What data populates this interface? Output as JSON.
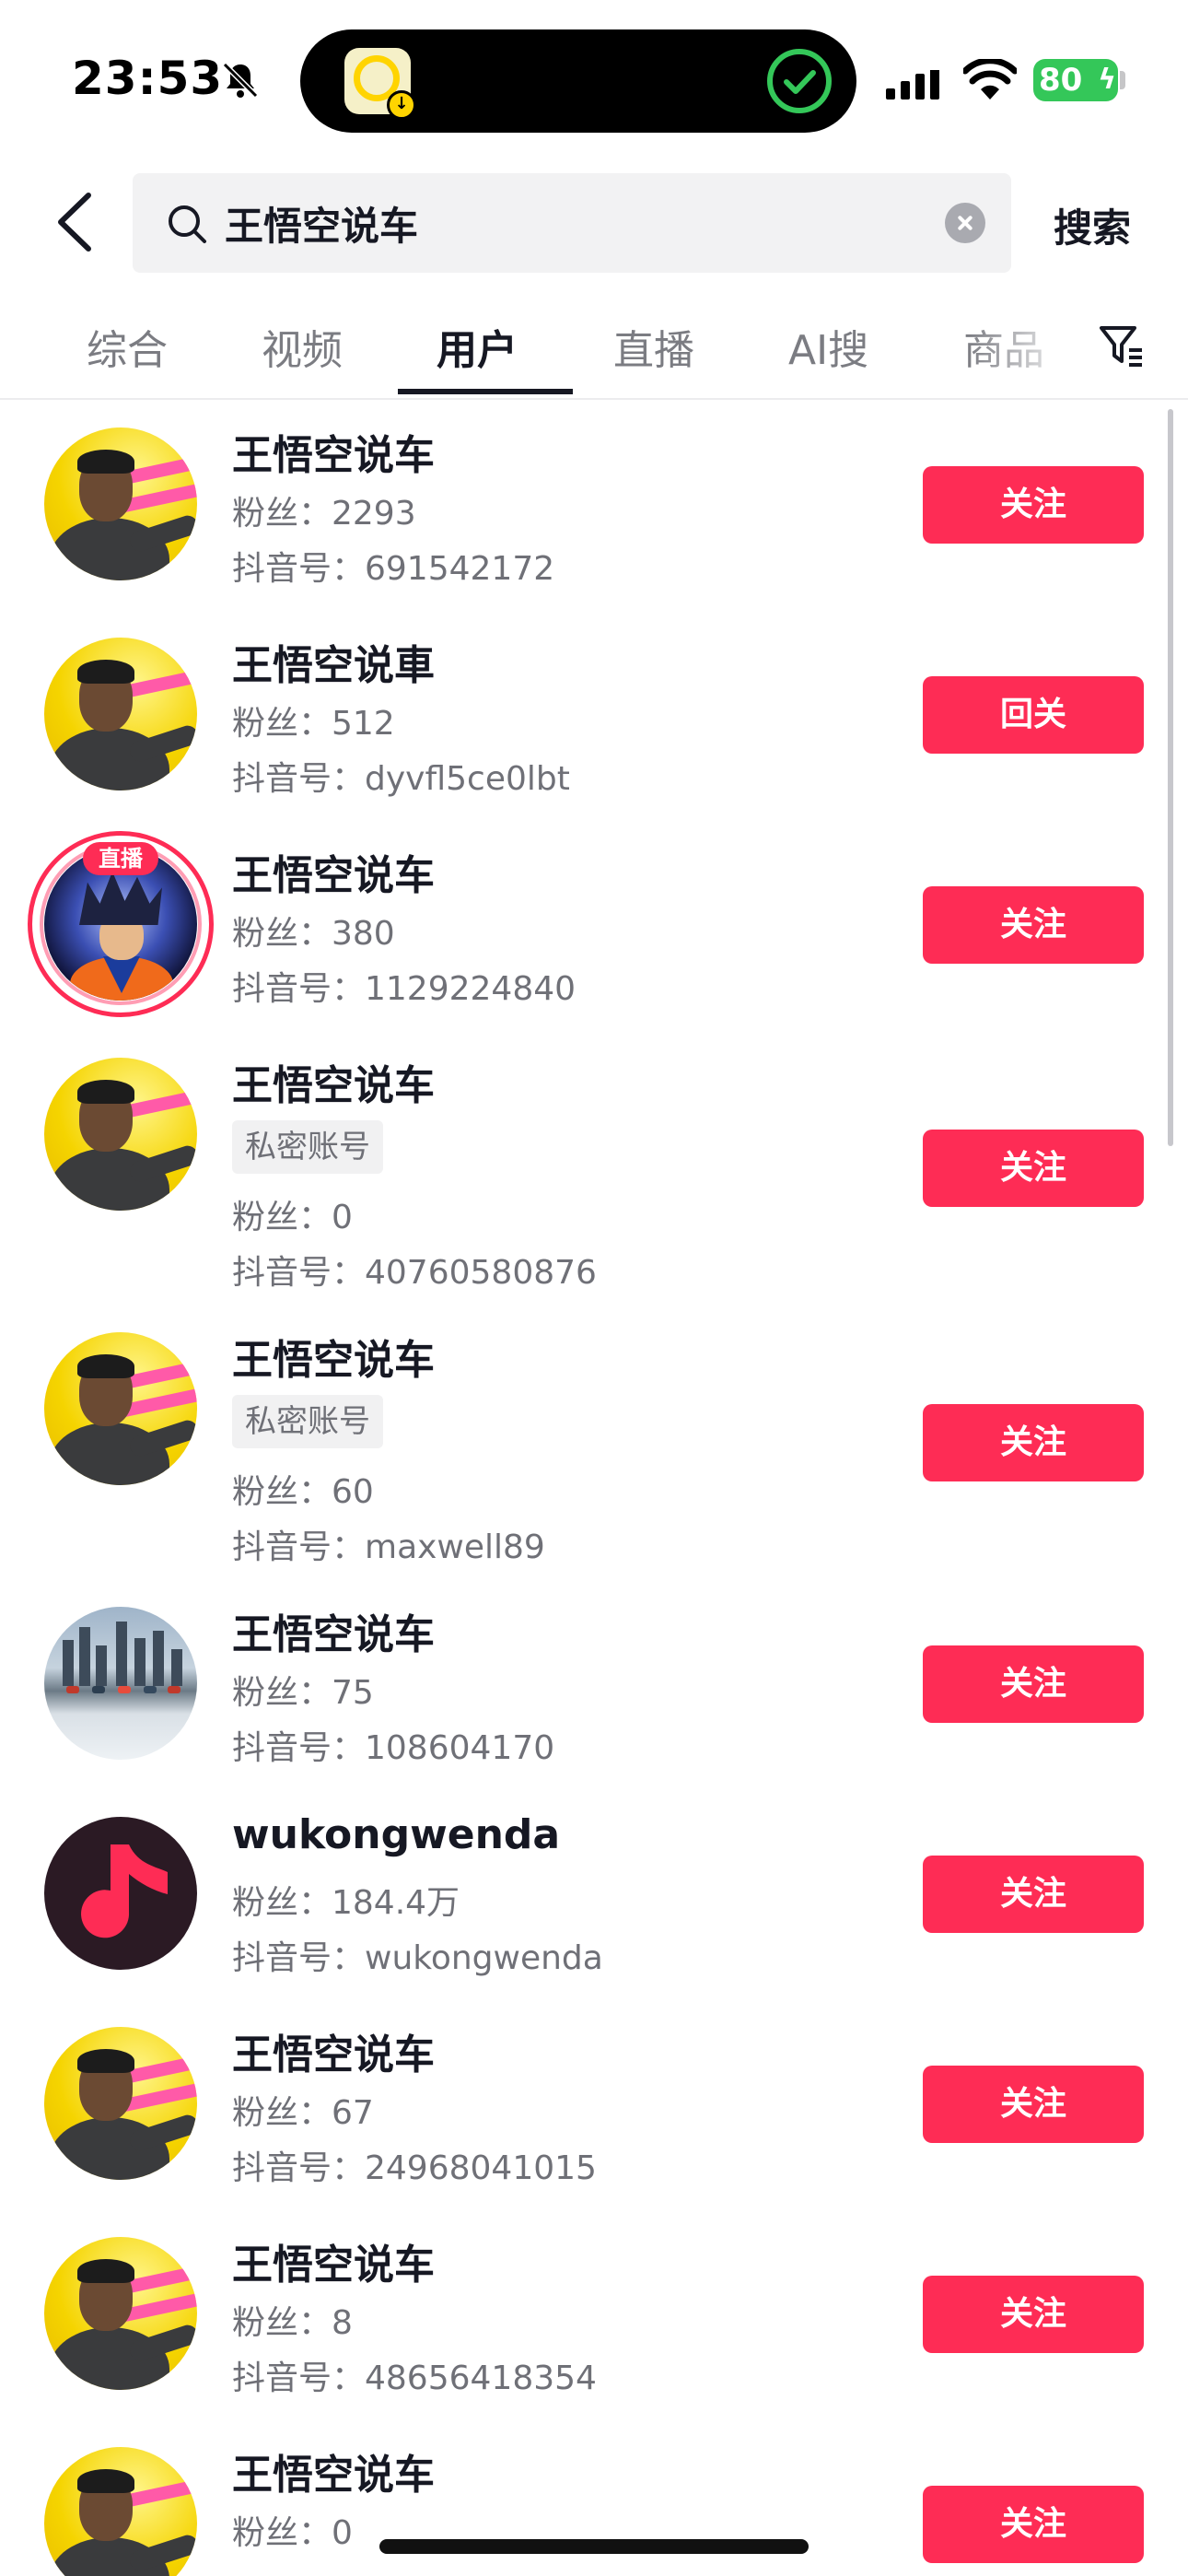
{
  "status_bar": {
    "time": "23:53",
    "battery": "80"
  },
  "search": {
    "query": "王悟空说车",
    "submit_label": "搜索"
  },
  "tabs": [
    {
      "label": "综合"
    },
    {
      "label": "视频"
    },
    {
      "label": "用户"
    },
    {
      "label": "直播"
    },
    {
      "label": "AI搜"
    },
    {
      "label": "商品"
    }
  ],
  "active_tab": "用户",
  "colors": {
    "accent": "#fe2c55",
    "text_primary": "#161823",
    "text_secondary": "#6f7077",
    "battery": "#34c759"
  },
  "users": [
    {
      "name": "王悟空说车",
      "fans": "粉丝：2293",
      "douyin_id": "抖音号：691542172",
      "button": "关注"
    },
    {
      "name": "王悟空说車",
      "fans": "粉丝：512",
      "douyin_id": "抖音号：dyvfl5ce0lbt",
      "button": "回关"
    },
    {
      "name": "王悟空说车",
      "live_badge": "直播",
      "fans": "粉丝：380",
      "douyin_id": "抖音号：1129224840",
      "button": "关注"
    },
    {
      "name": "王悟空说车",
      "tag": "私密账号",
      "fans": "粉丝：0",
      "douyin_id": "抖音号：40760580876",
      "button": "关注"
    },
    {
      "name": "王悟空说车",
      "tag": "私密账号",
      "fans": "粉丝：60",
      "douyin_id": "抖音号：maxwell89",
      "button": "关注"
    },
    {
      "name": "王悟空说车",
      "fans": "粉丝：75",
      "douyin_id": "抖音号：108604170",
      "button": "关注"
    },
    {
      "name": "wukongwenda",
      "fans": "粉丝：184.4万",
      "douyin_id": "抖音号：wukongwenda",
      "button": "关注"
    },
    {
      "name": "王悟空说车",
      "fans": "粉丝：67",
      "douyin_id": "抖音号：24968041015",
      "button": "关注"
    },
    {
      "name": "王悟空说车",
      "fans": "粉丝：8",
      "douyin_id": "抖音号：48656418354",
      "button": "关注"
    },
    {
      "name": "王悟空说车",
      "fans": "粉丝：0",
      "button": "关注"
    }
  ]
}
